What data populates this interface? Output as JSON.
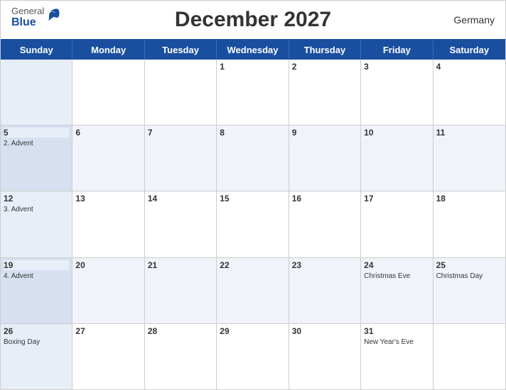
{
  "header": {
    "title": "December 2027",
    "country": "Germany",
    "logo_general": "General",
    "logo_blue": "Blue"
  },
  "day_headers": [
    "Sunday",
    "Monday",
    "Tuesday",
    "Wednesday",
    "Thursday",
    "Friday",
    "Saturday"
  ],
  "weeks": [
    [
      {
        "date": "",
        "holiday": "",
        "empty": true
      },
      {
        "date": "",
        "holiday": "",
        "empty": true
      },
      {
        "date": "",
        "holiday": "",
        "empty": true
      },
      {
        "date": "1",
        "holiday": ""
      },
      {
        "date": "2",
        "holiday": ""
      },
      {
        "date": "3",
        "holiday": ""
      },
      {
        "date": "4",
        "holiday": ""
      }
    ],
    [
      {
        "date": "5",
        "holiday": "2. Advent",
        "is_sunday": true
      },
      {
        "date": "6",
        "holiday": ""
      },
      {
        "date": "7",
        "holiday": ""
      },
      {
        "date": "8",
        "holiday": ""
      },
      {
        "date": "9",
        "holiday": ""
      },
      {
        "date": "10",
        "holiday": ""
      },
      {
        "date": "11",
        "holiday": ""
      }
    ],
    [
      {
        "date": "12",
        "holiday": "3. Advent",
        "is_sunday": true
      },
      {
        "date": "13",
        "holiday": ""
      },
      {
        "date": "14",
        "holiday": ""
      },
      {
        "date": "15",
        "holiday": ""
      },
      {
        "date": "16",
        "holiday": ""
      },
      {
        "date": "17",
        "holiday": ""
      },
      {
        "date": "18",
        "holiday": ""
      }
    ],
    [
      {
        "date": "19",
        "holiday": "4. Advent",
        "is_sunday": true
      },
      {
        "date": "20",
        "holiday": ""
      },
      {
        "date": "21",
        "holiday": ""
      },
      {
        "date": "22",
        "holiday": ""
      },
      {
        "date": "23",
        "holiday": ""
      },
      {
        "date": "24",
        "holiday": "Christmas Eve"
      },
      {
        "date": "25",
        "holiday": "Christmas Day"
      }
    ],
    [
      {
        "date": "26",
        "holiday": "Boxing Day",
        "is_sunday": true
      },
      {
        "date": "27",
        "holiday": ""
      },
      {
        "date": "28",
        "holiday": ""
      },
      {
        "date": "29",
        "holiday": ""
      },
      {
        "date": "30",
        "holiday": ""
      },
      {
        "date": "31",
        "holiday": "New Year's Eve"
      },
      {
        "date": "",
        "holiday": "",
        "empty": true
      }
    ]
  ]
}
